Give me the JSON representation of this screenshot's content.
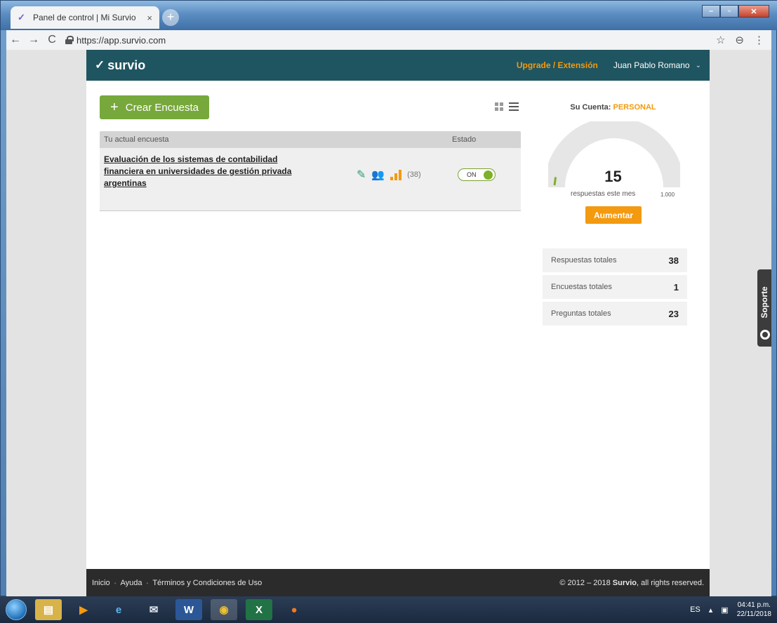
{
  "browser": {
    "tab_title": "Panel de control | Mi Survio",
    "tab_close": "×",
    "new_tab": "+",
    "url": "https://app.survio.com",
    "back": "←",
    "forward": "→",
    "reload": "C",
    "star": "☆",
    "account": "⊖",
    "menu": "⋮"
  },
  "window": {
    "minimize": "–",
    "maximize": "▫",
    "close": "✕"
  },
  "header": {
    "logo": "survio",
    "upgrade": "Upgrade / Extensión",
    "user": "Juan Pablo Romano",
    "chevron": "⌄"
  },
  "toolbar": {
    "create_label": "Crear Encuesta",
    "plus": "+"
  },
  "table": {
    "col_name": "Tu actual encuesta",
    "col_state": "Estado",
    "rows": [
      {
        "title": "Evaluación de los sistemas de contabilidad financiera en universidades de gestión privada argentinas",
        "responses": "(38)",
        "state": "ON"
      }
    ]
  },
  "account": {
    "label": "Su Cuenta:",
    "plan": "PERSONAL",
    "gauge_value": "15",
    "gauge_caption": "respuestas este mes",
    "gauge_max": "1.000",
    "gauge_fraction": 0.015,
    "boost": "Aumentar"
  },
  "stats": [
    {
      "label": "Respuestas totales",
      "value": "38"
    },
    {
      "label": "Encuestas totales",
      "value": "1"
    },
    {
      "label": "Preguntas totales",
      "value": "23"
    }
  ],
  "support": "Soporte",
  "footer": {
    "links": [
      "Inicio",
      "Ayuda",
      "Términos y Condiciones de Uso"
    ],
    "copyright_prefix": "© 2012 – 2018",
    "copyright_brand": "Survio",
    "copyright_suffix": ", all rights reserved."
  },
  "taskbar": {
    "lang": "ES",
    "time": "04:41 p.m.",
    "date": "22/11/2018"
  },
  "colors": {
    "header_bg": "#1f5560",
    "accent_orange": "#f39a10",
    "create_green": "#77a83b",
    "footer_bg": "#2b2b2b"
  }
}
